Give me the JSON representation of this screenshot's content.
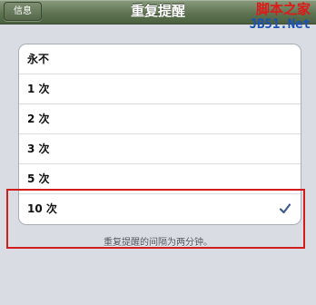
{
  "navbar": {
    "back_label": "信息",
    "title": "重复提醒"
  },
  "watermark": {
    "line1": "脚本之家",
    "line2": "JB51.Net"
  },
  "options": [
    {
      "label": "永不",
      "checked": false
    },
    {
      "label": "1 次",
      "checked": false
    },
    {
      "label": "2 次",
      "checked": false
    },
    {
      "label": "3 次",
      "checked": false
    },
    {
      "label": "5 次",
      "checked": false
    },
    {
      "label": "10 次",
      "checked": true
    }
  ],
  "footnote": "重复提醒的间隔为两分钟。",
  "colors": {
    "navbar": "#5f7552",
    "highlight": "#d21c1c",
    "check": "#3c5a8c"
  }
}
